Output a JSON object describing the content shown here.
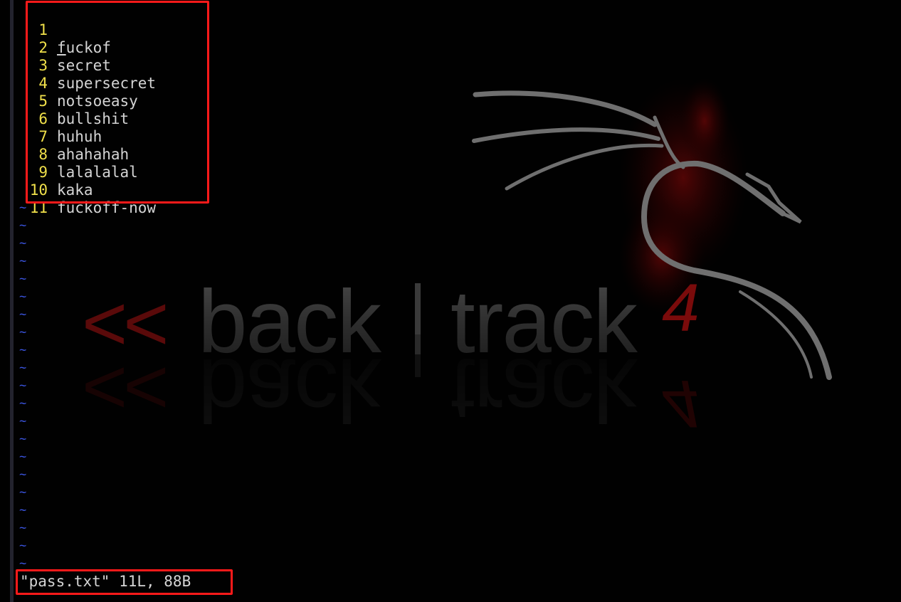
{
  "editor": {
    "lines": [
      {
        "num": "1",
        "text": "fuckof"
      },
      {
        "num": "2",
        "text": "secret"
      },
      {
        "num": "3",
        "text": "supersecret"
      },
      {
        "num": "4",
        "text": "notsoeasy"
      },
      {
        "num": "5",
        "text": "bullshit"
      },
      {
        "num": "6",
        "text": "huhuh"
      },
      {
        "num": "7",
        "text": "ahahahah"
      },
      {
        "num": "8",
        "text": "lalalalal"
      },
      {
        "num": "9",
        "text": "kaka"
      },
      {
        "num": "10",
        "text": "fuckoff-now"
      },
      {
        "num": "11",
        "text": ""
      }
    ],
    "empty_line_marker": "~",
    "cursor_char": "f",
    "cursor_rest": "uckof"
  },
  "status_line": "\"pass.txt\" 11L, 88B",
  "wallpaper": {
    "arrows": "<<",
    "word_left": "back",
    "separator": "|",
    "word_right": "track",
    "version": "4"
  },
  "colors": {
    "background": "#010101",
    "line_number": "#f0e04a",
    "text": "#d4d4d4",
    "tilde": "#3b55e0",
    "highlight_box": "#ff1a1a",
    "logo_red": "#8a0b0b"
  },
  "icons": [
    "dragon-logo-icon"
  ]
}
